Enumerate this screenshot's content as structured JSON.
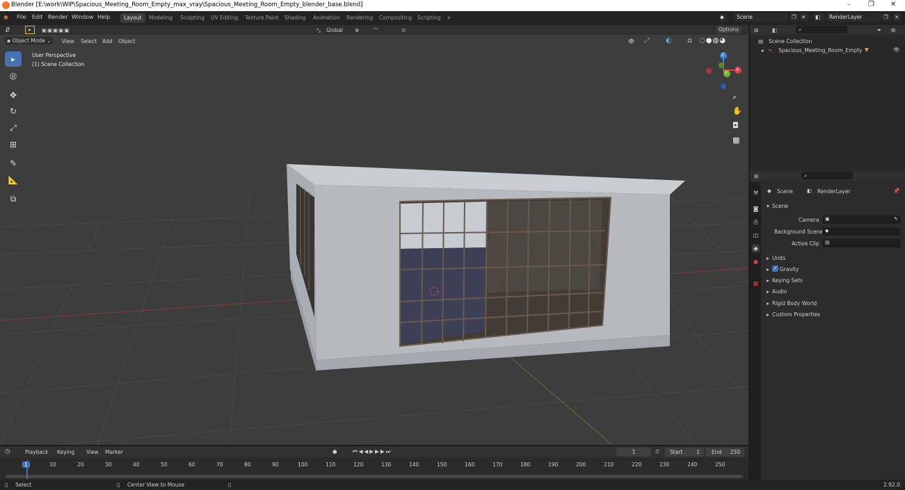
{
  "titlebar": {
    "title": "Blender [E:\\work\\WIP\\Spacious_Meeting_Room_Empty_max_vray\\Spacious_Meeting_Room_Empty_blender_base.blend]",
    "minimize": "–",
    "maximize": "❐",
    "close": "✕"
  },
  "menu": {
    "file": "File",
    "edit": "Edit",
    "render": "Render",
    "window": "Window",
    "help": "Help"
  },
  "workspaces": [
    "Layout",
    "Modeling",
    "Sculpting",
    "UV Editing",
    "Texture Paint",
    "Shading",
    "Animation",
    "Rendering",
    "Compositing",
    "Scripting",
    "+"
  ],
  "scene_selector": "Scene",
  "renderlayer_selector": "RenderLayer",
  "viewport": {
    "mode": "Object Mode",
    "menus": [
      "View",
      "Select",
      "Add",
      "Object"
    ],
    "transform_orientation": "Global",
    "options_label": "Options",
    "overlay_line1": "User Perspective",
    "overlay_line2": "(1) Scene Collection",
    "gizmo": {
      "x": "X",
      "y": "Y",
      "z": "Z"
    }
  },
  "outliner": {
    "root": "Scene Collection",
    "items": [
      "Spacious_Meeting_Room_Empty"
    ]
  },
  "properties": {
    "breadcrumb_scene": "Scene",
    "breadcrumb_layer": "RenderLayer",
    "section": "Scene",
    "camera_label": "Camera",
    "background_label": "Background Scene",
    "clip_label": "Active Clip",
    "panels": [
      "Units",
      "Gravity",
      "Keying Sets",
      "Audio",
      "Rigid Body World",
      "Custom Properties"
    ]
  },
  "timeline": {
    "menus": [
      "Playback",
      "Keying",
      "View",
      "Marker"
    ],
    "current_frame": "1",
    "start_label": "Start",
    "start_value": "1",
    "end_label": "End",
    "end_value": "250",
    "ticks": [
      "1",
      "10",
      "20",
      "30",
      "40",
      "50",
      "60",
      "70",
      "80",
      "90",
      "100",
      "110",
      "120",
      "130",
      "140",
      "150",
      "160",
      "170",
      "180",
      "190",
      "200",
      "210",
      "220",
      "230",
      "240",
      "250"
    ]
  },
  "statusbar": {
    "select": "Select",
    "center": "Center View to Mouse",
    "version": "2.92.0"
  },
  "colors": {
    "accent": "#4672b3",
    "active_tool": "#4672b3",
    "x_axis": "#e23e4a",
    "y_axis": "#7bb52b",
    "z_axis": "#3a7ee0"
  }
}
